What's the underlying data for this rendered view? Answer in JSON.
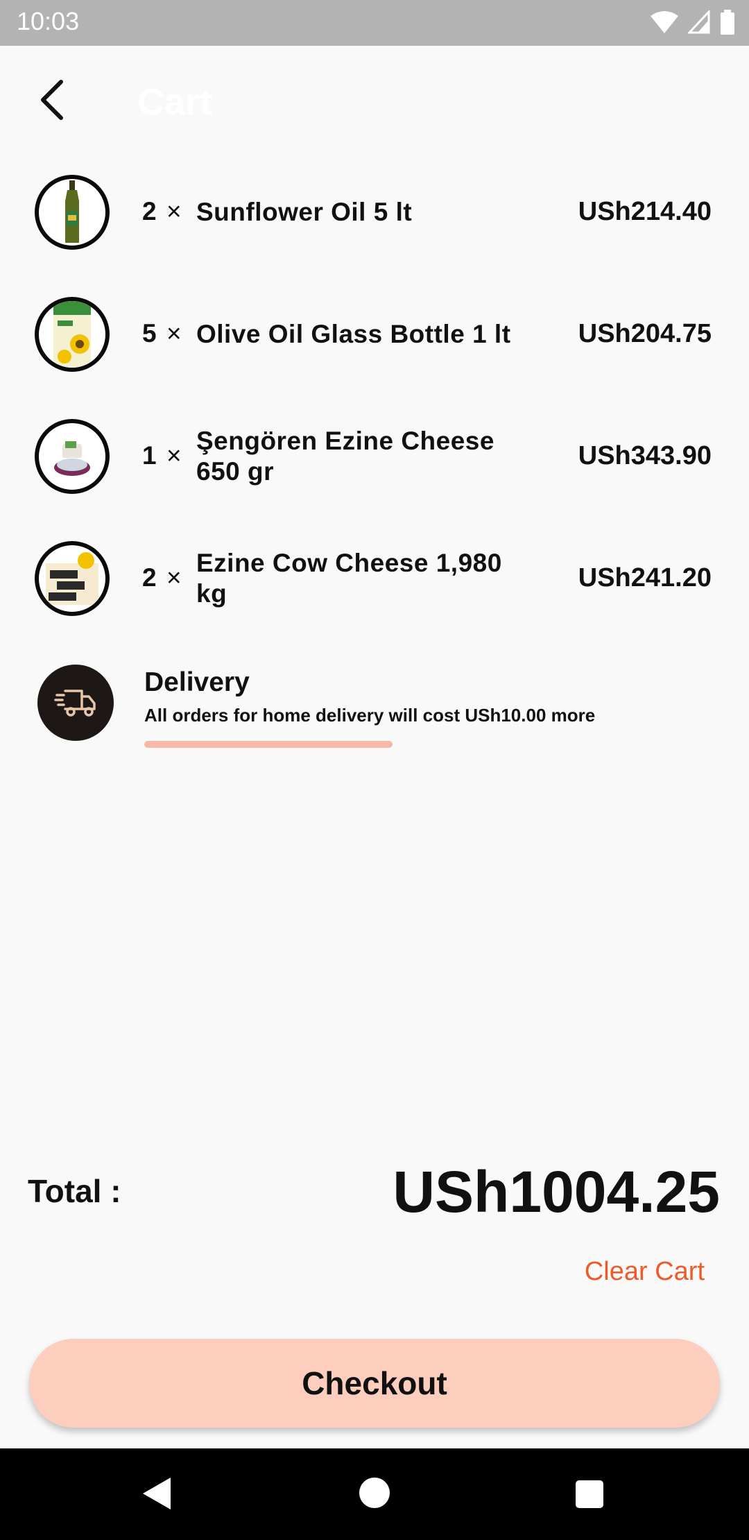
{
  "status_bar": {
    "time": "10:03"
  },
  "app_bar": {
    "title": "Cart"
  },
  "cart": {
    "items": [
      {
        "qty": "2",
        "times": "×",
        "name": "Sunflower Oil 5 lt",
        "price": "USh214.40"
      },
      {
        "qty": "5",
        "times": "×",
        "name": "Olive Oil Glass Bottle 1 lt",
        "price": "USh204.75"
      },
      {
        "qty": "1",
        "times": "×",
        "name": "Şengören Ezine Cheese 650 gr",
        "price": "USh343.90"
      },
      {
        "qty": "2",
        "times": "×",
        "name": "Ezine Cow Cheese 1,980 kg",
        "price": "USh241.20"
      }
    ]
  },
  "delivery": {
    "title": "Delivery",
    "description": "All orders for home delivery will cost USh10.00 more",
    "icon": "delivery-truck-icon"
  },
  "summary": {
    "total_label": "Total :",
    "total_value": "USh1004.25",
    "clear_cart_label": "Clear Cart",
    "checkout_label": "Checkout"
  },
  "colors": {
    "accent": "#f05a28",
    "checkout_bg": "#fdcdbd",
    "status_bar": "#b3b3b3"
  }
}
